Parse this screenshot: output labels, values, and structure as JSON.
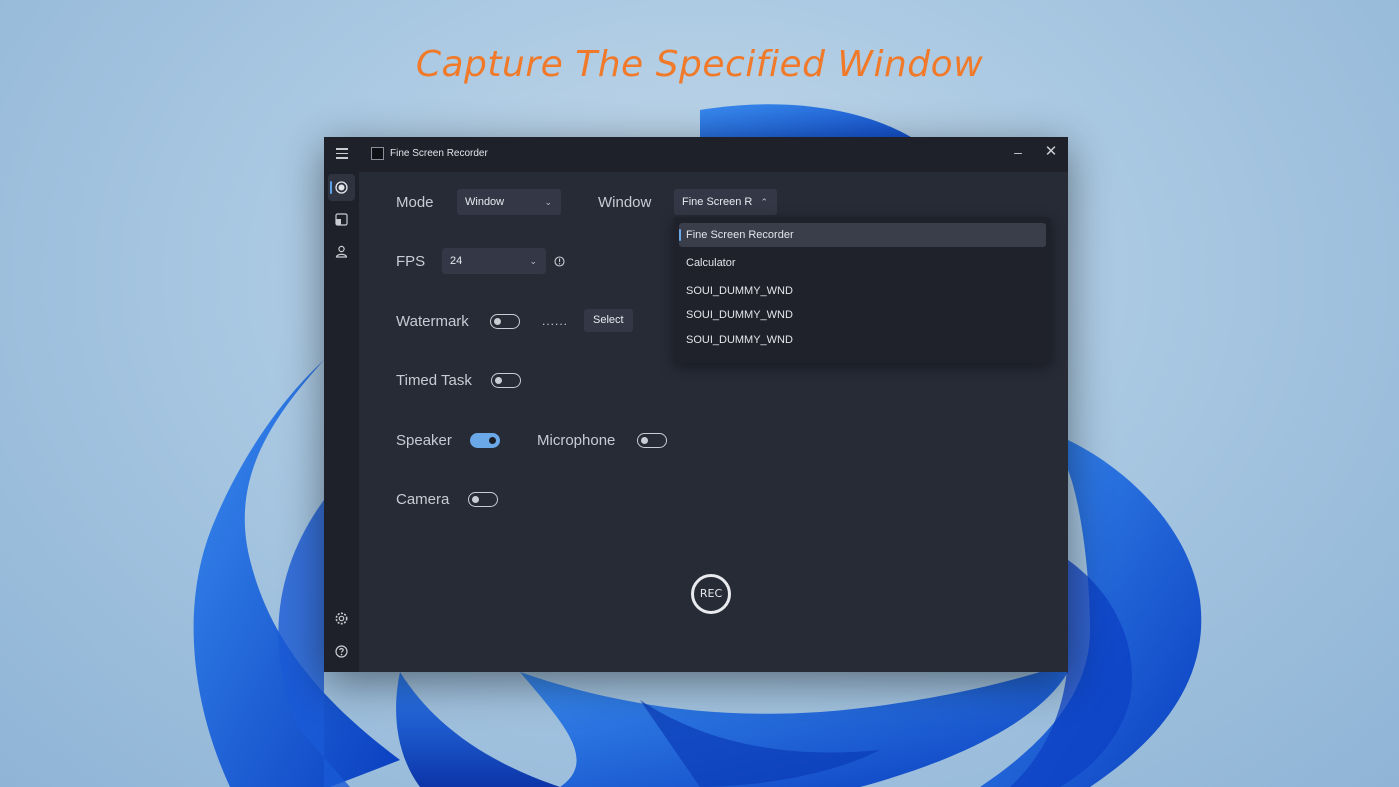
{
  "caption": "Capture The Specified Window",
  "window": {
    "title": "Fine Screen Recorder",
    "minimize_glyph": "–",
    "close_glyph": "✕"
  },
  "sidebar": {
    "items": [
      {
        "icon": "record-icon",
        "active": true
      },
      {
        "icon": "screenshot-icon",
        "active": false
      },
      {
        "icon": "camera-user-icon",
        "active": false
      }
    ],
    "bottom": [
      {
        "icon": "gear-icon"
      },
      {
        "icon": "help-icon"
      }
    ]
  },
  "settings": {
    "mode_label": "Mode",
    "mode_value": "Window",
    "window_label": "Window",
    "window_value": "Fine Screen R",
    "fps_label": "FPS",
    "fps_value": "24",
    "watermark_label": "Watermark",
    "watermark_on": false,
    "watermark_dots": "......",
    "select_label": "Select",
    "timed_task_label": "Timed Task",
    "timed_task_on": false,
    "speaker_label": "Speaker",
    "speaker_on": true,
    "microphone_label": "Microphone",
    "microphone_on": false,
    "camera_label": "Camera",
    "camera_on": false
  },
  "window_dropdown": {
    "options": [
      "Fine Screen Recorder",
      "Calculator",
      "SOUI_DUMMY_WND",
      "SOUI_DUMMY_WND",
      "SOUI_DUMMY_WND"
    ],
    "selected_index": 0
  },
  "rec_label": "REC",
  "colors": {
    "accent": "#6aa8e8",
    "caption": "#f07a2a",
    "window_bg": "#272b36",
    "sidebar_bg": "#1e212a"
  }
}
